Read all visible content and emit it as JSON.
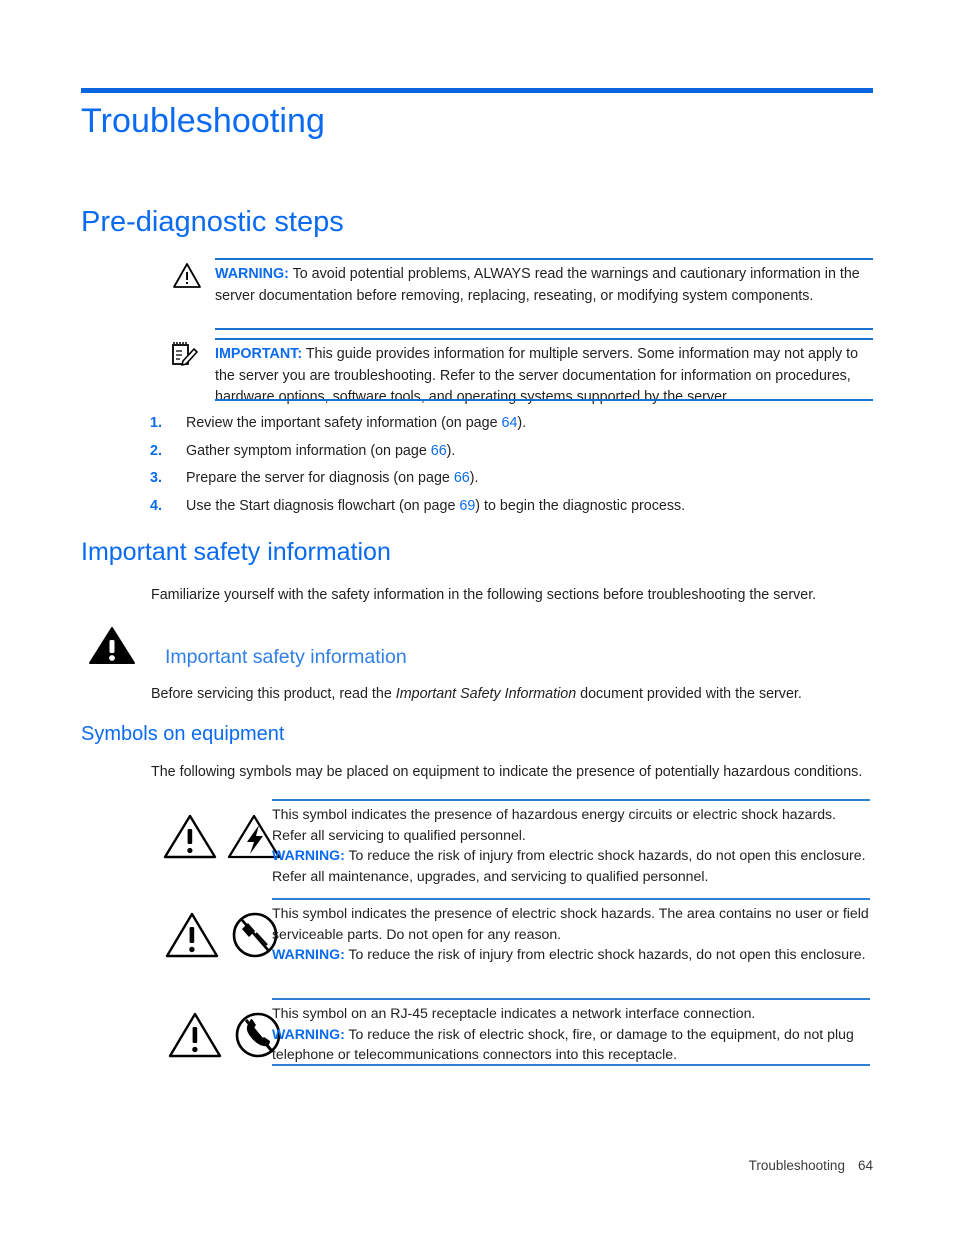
{
  "document": {
    "chapter_title": "Troubleshooting",
    "section_title": "Pre-diagnostic steps"
  },
  "colors": {
    "accent_blue": "#0a6bf0",
    "rule_blue": "#1a72d0",
    "table_rule_blue": "#2f7fd4",
    "body_text": "#231f20"
  },
  "admonitions": {
    "warning": {
      "icon": "warning-triangle-icon",
      "label": "WARNING:",
      "text": "To avoid potential problems, ALWAYS read the warnings and cautionary information in the server documentation before removing, replacing, reseating, or modifying system components."
    },
    "important": {
      "icon": "important-notepad-icon",
      "label": "IMPORTANT:",
      "text": "This guide provides information for multiple servers. Some information may not apply to the server you are troubleshooting. Refer to the server documentation for information on procedures, hardware options, software tools, and operating systems supported by the server."
    }
  },
  "steps": [
    {
      "num": "1.",
      "text_before": "Review the important safety information (on page ",
      "page": "64",
      "text_after": ")."
    },
    {
      "num": "2.",
      "text_before": "Gather symptom information (on page ",
      "page": "66",
      "text_after": ")."
    },
    {
      "num": "3.",
      "text_before": "Prepare the server for diagnosis (on page ",
      "page": "66",
      "text_after": ")."
    },
    {
      "num": "4.",
      "text_before": "Use the Start diagnosis flowchart (on page ",
      "page": "69",
      "text_after": ") to begin the diagnostic process."
    }
  ],
  "important_safety": {
    "heading": "Important safety information",
    "intro": "Familiarize yourself with the safety information in the following sections before troubleshooting the server.",
    "callout_icon": "filled-warning-triangle-icon",
    "callout_heading": "Important safety information",
    "callout_text_before": "Before servicing this product, read the ",
    "callout_text_italic": "Important Safety Information",
    "callout_text_after": " document provided with the server."
  },
  "symbols_section": {
    "heading": "Symbols on equipment",
    "intro": "The following symbols may be placed on equipment to indicate the presence of potentially hazardous conditions.",
    "rows": [
      {
        "icons": [
          "warning-triangle-exclamation-icon",
          "lightning-bolt-triangle-icon"
        ],
        "text": "This symbol indicates the presence of hazardous energy circuits or electric shock hazards. Refer all servicing to qualified personnel.",
        "warning_label": "WARNING:",
        "warning_text": "To reduce the risk of injury from electric shock hazards, do not open this enclosure. Refer all maintenance, upgrades, and servicing to qualified personnel."
      },
      {
        "icons": [
          "warning-triangle-exclamation-icon",
          "no-serviceable-parts-icon"
        ],
        "text": "This symbol indicates the presence of electric shock hazards. The area contains no user or field serviceable parts. Do not open for any reason.",
        "warning_label": "WARNING:",
        "warning_text": "To reduce the risk of injury from electric shock hazards, do not open this enclosure."
      },
      {
        "icons": [
          "warning-triangle-exclamation-icon",
          "no-telephone-icon"
        ],
        "text": "This symbol on an RJ-45 receptacle indicates a network interface connection.",
        "warning_label": "WARNING:",
        "warning_text": "To reduce the risk of electric shock, fire, or damage to the equipment, do not plug telephone or telecommunications connectors into this receptacle."
      }
    ]
  },
  "footer": {
    "label": "Troubleshooting",
    "page_number": "64"
  }
}
